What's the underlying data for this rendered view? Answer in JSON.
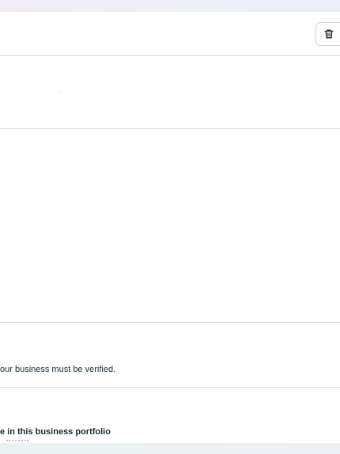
{
  "toolbar": {
    "delete_button": {
      "icon": "trash-icon",
      "label": ""
    }
  },
  "verification_section": {
    "text": "our business must be verified."
  },
  "portfolio_section": {
    "heading": "e in this business portfolio"
  }
}
